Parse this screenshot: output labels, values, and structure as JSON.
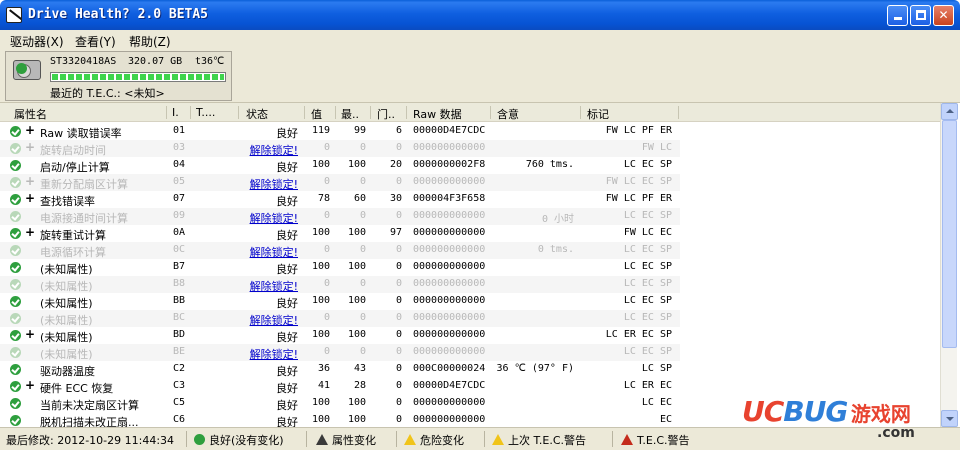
{
  "window": {
    "title": "Drive Health? 2.0 BETA5"
  },
  "menu": [
    {
      "label": "驱动器(X)"
    },
    {
      "label": "查看(Y)"
    },
    {
      "label": "帮助(Z)"
    }
  ],
  "drive": {
    "model": "ST3320418AS",
    "size": "320.07 GB",
    "temp": "t36℃",
    "health_level": 1.0,
    "tec": "最近的 T.E.C.: <未知>"
  },
  "columns": [
    "属性名",
    "I.",
    "T....",
    "状态",
    "值",
    "最..",
    "门..",
    "Raw 数据",
    "含意",
    "标记"
  ],
  "rows": [
    {
      "plus": "+",
      "name": "Raw 读取错误率",
      "id": "01",
      "status": "良好",
      "value": "119",
      "worst": "99",
      "threshold": "6",
      "raw": "00000D4E7CDC",
      "meaning": "",
      "flags": "FW LC PF ER",
      "dim": false
    },
    {
      "plus": "+",
      "name": "旋转启动时间",
      "id": "03",
      "status": "解除锁定!",
      "value": "0",
      "worst": "0",
      "threshold": "0",
      "raw": "000000000000",
      "meaning": "",
      "flags": "FW LC",
      "dim": true
    },
    {
      "plus": "",
      "name": "启动/停止计算",
      "id": "04",
      "status": "良好",
      "value": "100",
      "worst": "100",
      "threshold": "20",
      "raw": "0000000002F8",
      "meaning": "760 tms.",
      "flags": "LC EC SP",
      "dim": false
    },
    {
      "plus": "+",
      "name": "重新分配扇区计算",
      "id": "05",
      "status": "解除锁定!",
      "value": "0",
      "worst": "0",
      "threshold": "0",
      "raw": "000000000000",
      "meaning": "",
      "flags": "FW LC EC SP",
      "dim": true
    },
    {
      "plus": "+",
      "name": "查找错误率",
      "id": "07",
      "status": "良好",
      "value": "78",
      "worst": "60",
      "threshold": "30",
      "raw": "000004F3F658",
      "meaning": "",
      "flags": "FW LC PF ER",
      "dim": false
    },
    {
      "plus": "",
      "name": "电源接通时间计算",
      "id": "09",
      "status": "解除锁定!",
      "value": "0",
      "worst": "0",
      "threshold": "0",
      "raw": "000000000000",
      "meaning": "0 小时",
      "flags": "LC EC SP",
      "dim": true
    },
    {
      "plus": "+",
      "name": "旋转重试计算",
      "id": "0A",
      "status": "良好",
      "value": "100",
      "worst": "100",
      "threshold": "97",
      "raw": "000000000000",
      "meaning": "",
      "flags": "FW LC EC",
      "dim": false
    },
    {
      "plus": "",
      "name": "电源循环计算",
      "id": "0C",
      "status": "解除锁定!",
      "value": "0",
      "worst": "0",
      "threshold": "0",
      "raw": "000000000000",
      "meaning": "0 tms.",
      "flags": "LC EC SP",
      "dim": true
    },
    {
      "plus": "",
      "name": "(未知属性)",
      "id": "B7",
      "status": "良好",
      "value": "100",
      "worst": "100",
      "threshold": "0",
      "raw": "000000000000",
      "meaning": "",
      "flags": "LC EC SP",
      "dim": false
    },
    {
      "plus": "",
      "name": "(未知属性)",
      "id": "B8",
      "status": "解除锁定!",
      "value": "0",
      "worst": "0",
      "threshold": "0",
      "raw": "000000000000",
      "meaning": "",
      "flags": "LC EC SP",
      "dim": true
    },
    {
      "plus": "",
      "name": "(未知属性)",
      "id": "BB",
      "status": "良好",
      "value": "100",
      "worst": "100",
      "threshold": "0",
      "raw": "000000000000",
      "meaning": "",
      "flags": "LC EC SP",
      "dim": false
    },
    {
      "plus": "",
      "name": "(未知属性)",
      "id": "BC",
      "status": "解除锁定!",
      "value": "0",
      "worst": "0",
      "threshold": "0",
      "raw": "000000000000",
      "meaning": "",
      "flags": "LC EC SP",
      "dim": true
    },
    {
      "plus": "+",
      "name": "(未知属性)",
      "id": "BD",
      "status": "良好",
      "value": "100",
      "worst": "100",
      "threshold": "0",
      "raw": "000000000000",
      "meaning": "",
      "flags": "LC ER EC SP",
      "dim": false
    },
    {
      "plus": "",
      "name": "(未知属性)",
      "id": "BE",
      "status": "解除锁定!",
      "value": "0",
      "worst": "0",
      "threshold": "0",
      "raw": "000000000000",
      "meaning": "",
      "flags": "LC EC SP",
      "dim": true
    },
    {
      "plus": "",
      "name": "驱动器温度",
      "id": "C2",
      "status": "良好",
      "value": "36",
      "worst": "43",
      "threshold": "0",
      "raw": "000C00000024",
      "meaning": "36 ℃ (97° F)",
      "flags": "LC SP",
      "dim": false
    },
    {
      "plus": "+",
      "name": "硬件 ECC 恢复",
      "id": "C3",
      "status": "良好",
      "value": "41",
      "worst": "28",
      "threshold": "0",
      "raw": "00000D4E7CDC",
      "meaning": "",
      "flags": "LC ER EC",
      "dim": false
    },
    {
      "plus": "",
      "name": "当前未决定扇区计算",
      "id": "C5",
      "status": "良好",
      "value": "100",
      "worst": "100",
      "threshold": "0",
      "raw": "000000000000",
      "meaning": "",
      "flags": "LC EC",
      "dim": false
    },
    {
      "plus": "",
      "name": "脱机扫描未改正扇...",
      "id": "C6",
      "status": "良好",
      "value": "100",
      "worst": "100",
      "threshold": "0",
      "raw": "000000000000",
      "meaning": "",
      "flags": "EC",
      "dim": false
    }
  ],
  "statusbar": {
    "last_modified": "最后修改: 2012-10-29 11:44:34",
    "good": "良好(没有变化)",
    "attr_change": "属性变化",
    "danger_change": "危险变化",
    "last_tec": "上次 T.E.C.警告",
    "tec_warning": "T.E.C.警告"
  },
  "watermark": {
    "uc": "UC",
    "bug": "BUG",
    "cn": "游戏网",
    "com": ".com"
  },
  "icons": {
    "ok": "check-circle-icon",
    "warn": "warning-triangle-icon"
  },
  "colors": {
    "ok": "#2e9f3e",
    "link": "#0000cc",
    "titlebar": "#0753d3",
    "watermark_red": "#e8432f",
    "watermark_blue": "#2f7fd8"
  }
}
